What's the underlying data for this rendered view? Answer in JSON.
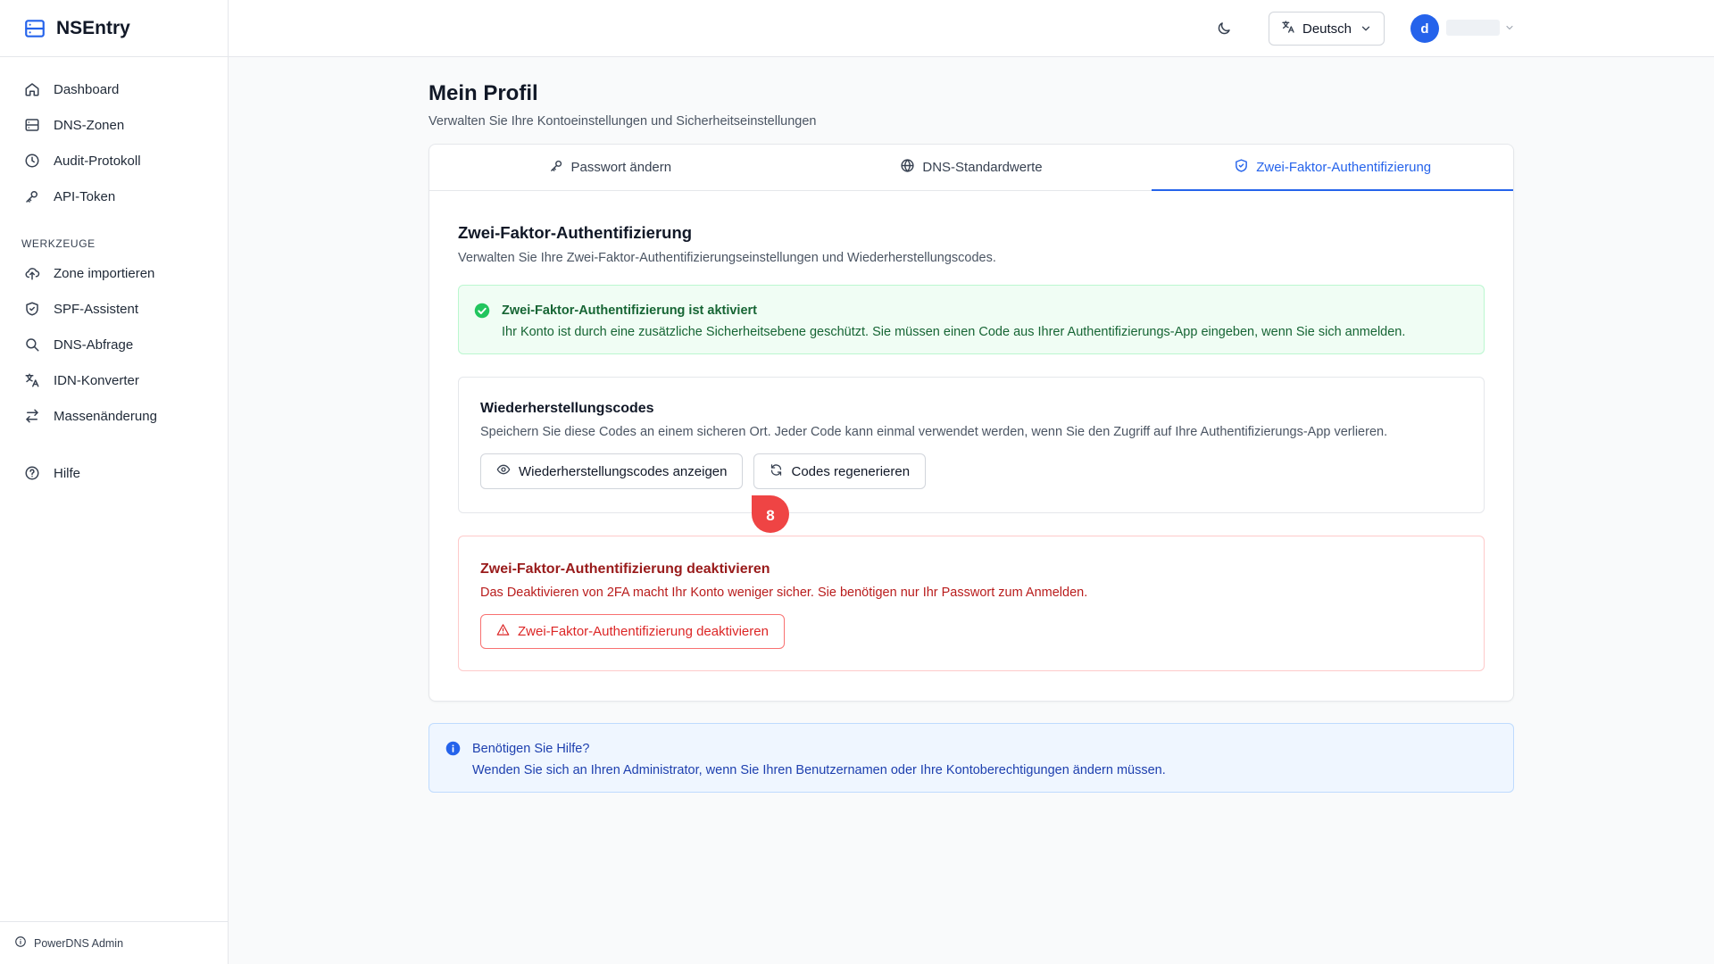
{
  "brand": {
    "name": "NSEntry",
    "icon": "server-icon",
    "color": "#2563eb"
  },
  "sidebar": {
    "items": [
      {
        "label": "Dashboard",
        "icon": "home-icon"
      },
      {
        "label": "DNS-Zonen",
        "icon": "server-icon"
      },
      {
        "label": "Audit-Protokoll",
        "icon": "clock-icon"
      },
      {
        "label": "API-Token",
        "icon": "key-icon"
      }
    ],
    "tools_heading": "WERKZEUGE",
    "tools": [
      {
        "label": "Zone importieren",
        "icon": "cloud-upload-icon"
      },
      {
        "label": "SPF-Assistent",
        "icon": "shield-icon"
      },
      {
        "label": "DNS-Abfrage",
        "icon": "search-icon"
      },
      {
        "label": "IDN-Konverter",
        "icon": "translate-icon"
      },
      {
        "label": "Massenänderung",
        "icon": "arrows-exchange-icon"
      }
    ],
    "help": {
      "label": "Hilfe",
      "icon": "help-circle-icon"
    },
    "footer": "PowerDNS Admin"
  },
  "topbar": {
    "theme_icon": "moon-icon",
    "language": "Deutsch",
    "avatar_initial": "d"
  },
  "page": {
    "title": "Mein Profil",
    "subtitle": "Verwalten Sie Ihre Kontoeinstellungen und Sicherheitseinstellungen"
  },
  "tabs": [
    {
      "label": "Passwort ändern",
      "icon": "key-icon",
      "active": false
    },
    {
      "label": "DNS-Standardwerte",
      "icon": "globe-icon",
      "active": false
    },
    {
      "label": "Zwei-Faktor-Authentifizierung",
      "icon": "shield-check-icon",
      "active": true
    }
  ],
  "twofa": {
    "title": "Zwei-Faktor-Authentifizierung",
    "subtitle": "Verwalten Sie Ihre Zwei-Faktor-Authentifizierungseinstellungen und Wiederherstellungscodes.",
    "status_title": "Zwei-Faktor-Authentifizierung ist aktiviert",
    "status_text": "Ihr Konto ist durch eine zusätzliche Sicherheitsebene geschützt. Sie müssen einen Code aus Ihrer Authentifizierungs-App eingeben, wenn Sie sich anmelden.",
    "recovery_title": "Wiederherstellungscodes",
    "recovery_text": "Speichern Sie diese Codes an einem sicheren Ort. Jeder Code kann einmal verwendet werden, wenn Sie den Zugriff auf Ihre Authentifizierungs-App verlieren.",
    "show_codes_button": "Wiederherstellungscodes anzeigen",
    "regenerate_button": "Codes regenerieren",
    "step_marker": "8",
    "disable_title": "Zwei-Faktor-Authentifizierung deaktivieren",
    "disable_text": "Das Deaktivieren von 2FA macht Ihr Konto weniger sicher. Sie benötigen nur Ihr Passwort zum Anmelden.",
    "disable_button": "Zwei-Faktor-Authentifizierung deaktivieren"
  },
  "help_box": {
    "title": "Benötigen Sie Hilfe?",
    "text": "Wenden Sie sich an Ihren Administrator, wenn Sie Ihren Benutzernamen oder Ihre Kontoberechtigungen ändern müssen."
  },
  "colors": {
    "accent": "#2563eb",
    "success": "#22c55e",
    "danger": "#dc2626",
    "marker": "#ef4444"
  }
}
